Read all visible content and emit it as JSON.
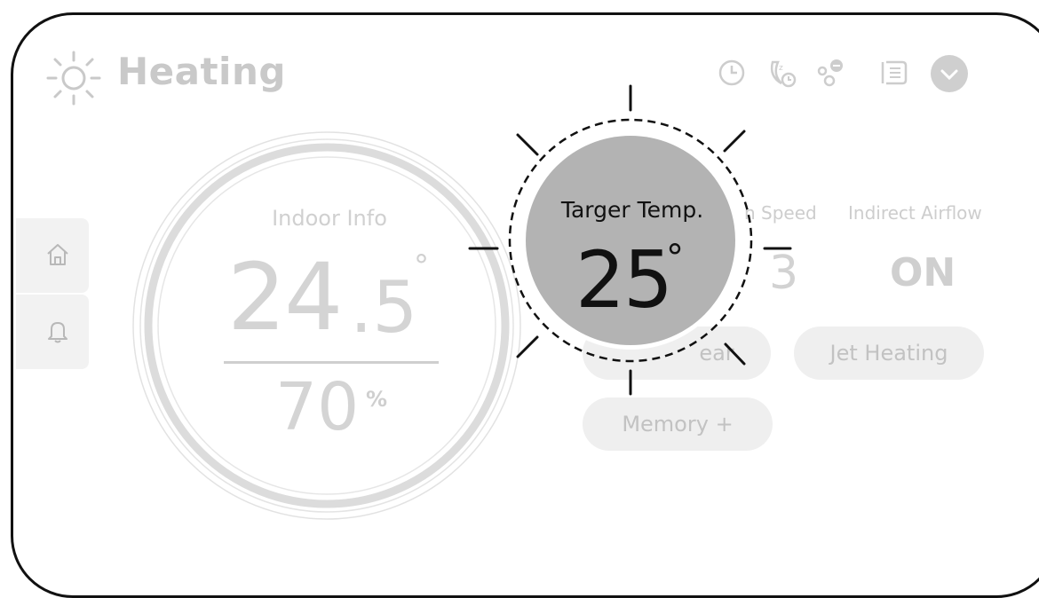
{
  "header": {
    "mode_label": "Heating",
    "mode_icon": "sun-icon",
    "icons": [
      "timer-icon",
      "sleep-timer-icon",
      "filter-icon",
      "display-icon",
      "chevron-down-icon"
    ]
  },
  "side_nav": {
    "items": [
      {
        "icon": "home-icon"
      },
      {
        "icon": "bell-icon"
      }
    ]
  },
  "indoor": {
    "label": "Indoor Info",
    "temp_int": "24",
    "temp_dec": ".5",
    "temp_unit": "°",
    "humidity": "70",
    "humidity_unit": "%"
  },
  "fan_speed": {
    "label": "n Speed",
    "value": "3"
  },
  "indirect_airflow": {
    "label": "Indirect Airflow",
    "value": "ON"
  },
  "buttons": {
    "partial_label": "ear",
    "jet_heating": "Jet Heating",
    "memory": "Memory +"
  },
  "target": {
    "label": "Targer Temp.",
    "value": "25",
    "unit": "°"
  },
  "colors": {
    "disabled_text": "#c9c9c9",
    "target_circle": "#b3b3b3",
    "frame": "#111111"
  }
}
